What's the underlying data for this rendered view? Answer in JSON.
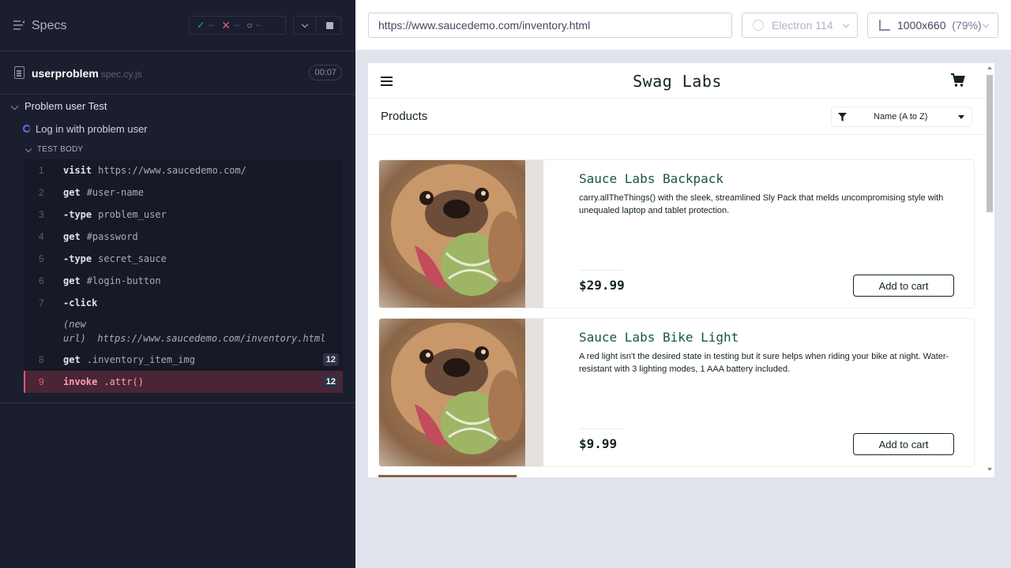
{
  "reporter": {
    "specs_label": "Specs",
    "stats": {
      "passed": "--",
      "failed": "--",
      "pending": "--"
    },
    "spec": {
      "name": "userproblem",
      "ext": "spec.cy.js",
      "duration": "00:07"
    },
    "suite_title": "Problem user Test",
    "test_title": "Log in with problem user",
    "body_label": "TEST BODY",
    "commands": [
      {
        "num": "1",
        "name": "visit",
        "arg": "https://www.saucedemo.com/"
      },
      {
        "num": "2",
        "name": "get",
        "arg": "#user-name"
      },
      {
        "num": "3",
        "name": "-type",
        "arg": "problem_user"
      },
      {
        "num": "4",
        "name": "get",
        "arg": "#password"
      },
      {
        "num": "5",
        "name": "-type",
        "arg": "secret_sauce"
      },
      {
        "num": "6",
        "name": "get",
        "arg": "#login-button"
      },
      {
        "num": "7",
        "name": "-click",
        "arg": ""
      },
      {
        "num": "",
        "name": "(new url)",
        "arg": "https://www.saucedemo.com/inventory.html"
      },
      {
        "num": "8",
        "name": "get",
        "arg": ".inventory_item_img",
        "badge": "12"
      },
      {
        "num": "9",
        "name": "invoke",
        "arg": ".attr()",
        "badge": "12",
        "state": "failed"
      }
    ]
  },
  "aut": {
    "url": "https://www.saucedemo.com/inventory.html",
    "browser": "Electron 114",
    "viewport": "1000x660",
    "scale": "(79%)"
  },
  "app": {
    "logo": "Swag Labs",
    "products_title": "Products",
    "sort_selected": "Name (A to Z)",
    "items": [
      {
        "name": "Sauce Labs Backpack",
        "desc": "carry.allTheThings() with the sleek, streamlined Sly Pack that melds uncompromising style with unequaled laptop and tablet protection.",
        "price": "$29.99",
        "button": "Add to cart"
      },
      {
        "name": "Sauce Labs Bike Light",
        "desc": "A red light isn't the desired state in testing but it sure helps when riding your bike at night. Water-resistant with 3 lighting modes, 1 AAA battery included.",
        "price": "$9.99",
        "button": "Add to cart"
      }
    ]
  },
  "colors": {
    "reporter_bg": "#1b1e2e",
    "failed_row_bg": "#4a2536",
    "failed_accent": "#e45770",
    "pass_green": "#1fa971",
    "item_name": "#18583a"
  }
}
